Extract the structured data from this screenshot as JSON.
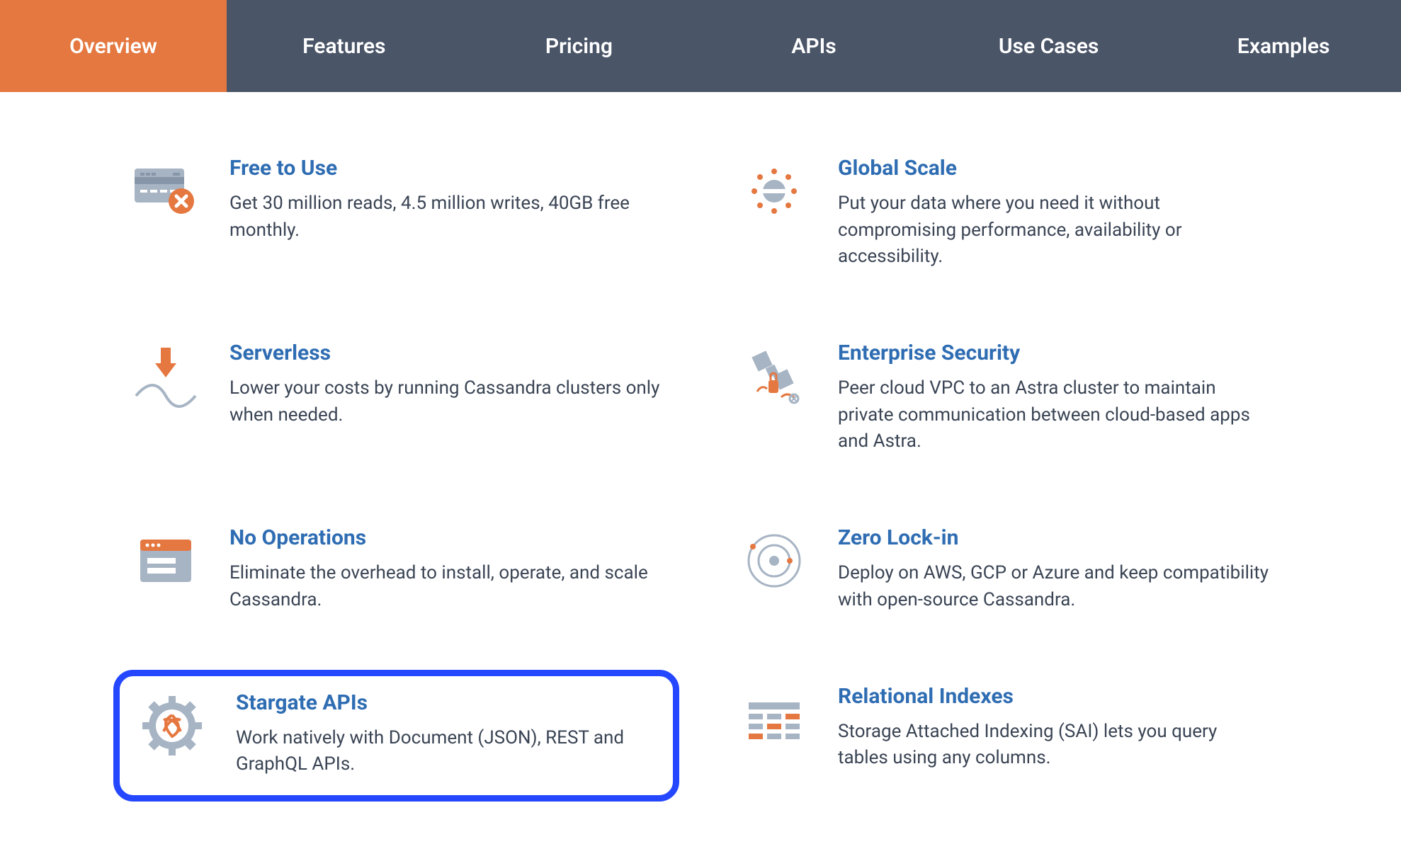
{
  "nav": {
    "tabs": [
      {
        "label": "Overview",
        "active": true
      },
      {
        "label": "Features",
        "active": false
      },
      {
        "label": "Pricing",
        "active": false
      },
      {
        "label": "APIs",
        "active": false
      },
      {
        "label": "Use Cases",
        "active": false
      },
      {
        "label": "Examples",
        "active": false
      }
    ]
  },
  "features": {
    "left": [
      {
        "title": "Free to Use",
        "desc": "Get 30 million reads, 4.5 million writes, 40GB free monthly.",
        "icon": "credit-card-x-icon",
        "highlight": false
      },
      {
        "title": "Serverless",
        "desc": "Lower your costs by running Cassandra clusters only when needed.",
        "icon": "serverless-arrow-icon",
        "highlight": false
      },
      {
        "title": "No Operations",
        "desc": "Eliminate the overhead to install, operate, and scale Cassandra.",
        "icon": "ops-window-icon",
        "highlight": false
      },
      {
        "title": "Stargate APIs",
        "desc": "Work natively with Document (JSON), REST and GraphQL APIs.",
        "icon": "stargate-gear-icon",
        "highlight": true
      }
    ],
    "right": [
      {
        "title": "Global Scale",
        "desc": "Put your data where you need it without compromising performance, availability or accessibility.",
        "icon": "global-scale-icon",
        "highlight": false
      },
      {
        "title": "Enterprise Security",
        "desc": "Peer cloud VPC to an Astra cluster to maintain private communication between cloud-based apps and Astra.",
        "icon": "security-satellite-icon",
        "highlight": false
      },
      {
        "title": "Zero Lock-in",
        "desc": "Deploy on AWS, GCP or Azure and keep compatibility with open-source Cassandra.",
        "icon": "orbit-icon",
        "highlight": false
      },
      {
        "title": "Relational Indexes",
        "desc": "Storage Attached Indexing (SAI) lets you query tables using any columns.",
        "icon": "indexes-icon",
        "highlight": false
      }
    ]
  },
  "colors": {
    "accent": "#e57840",
    "highlight": "#2447ff",
    "link": "#2f6db3",
    "nav": "#4a5568"
  }
}
